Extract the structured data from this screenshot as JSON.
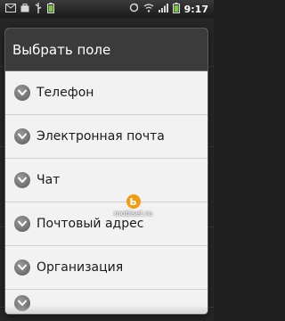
{
  "status_bar": {
    "time": "9:17",
    "icons_left": [
      "mail-icon",
      "briefcase-icon",
      "usb-icon",
      "battery-icon"
    ],
    "icons_right": [
      "sync-icon",
      "wifi-icon",
      "signal-icon",
      "battery-icon"
    ]
  },
  "dialog": {
    "title": "Выбрать поле",
    "items": [
      {
        "label": "Телефон"
      },
      {
        "label": "Электронная почта"
      },
      {
        "label": "Чат"
      },
      {
        "label": "Почтовый адрес"
      },
      {
        "label": "Организация"
      }
    ]
  },
  "watermark": {
    "text": "mobiset.ru",
    "logo_glyph": "Ь"
  },
  "colors": {
    "title_bg": "#3b3b3b",
    "list_bg": "#f2f2f2",
    "accent": "#f39c12"
  }
}
